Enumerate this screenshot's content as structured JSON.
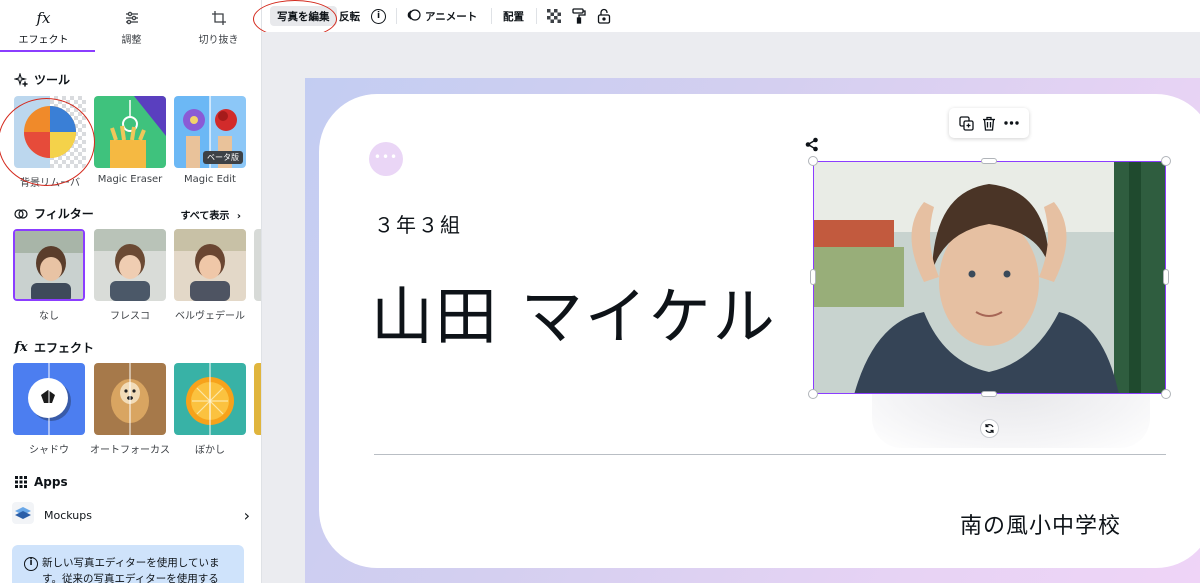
{
  "panel": {
    "tabs": [
      {
        "label": "エフェクト",
        "icon": "fx-icon",
        "glyph": "fx"
      },
      {
        "label": "調整",
        "icon": "sliders-icon"
      },
      {
        "label": "切り抜き",
        "icon": "crop-icon"
      }
    ],
    "tools": {
      "title": "ツール",
      "items": [
        {
          "label": "背景リムーバ"
        },
        {
          "label": "Magic Eraser"
        },
        {
          "label": "Magic Edit",
          "badge": "ベータ版"
        }
      ]
    },
    "filters": {
      "title": "フィルター",
      "show_all": "すべて表示",
      "items": [
        {
          "label": "なし"
        },
        {
          "label": "フレスコ"
        },
        {
          "label": "ベルヴェデール"
        }
      ]
    },
    "effects": {
      "title": "エフェクト",
      "glyph": "fx",
      "items": [
        {
          "label": "シャドウ"
        },
        {
          "label": "オートフォーカス"
        },
        {
          "label": "ぼかし"
        }
      ]
    },
    "apps": {
      "title": "Apps",
      "items": [
        {
          "label": "Mockups"
        }
      ]
    },
    "notice": {
      "text": "新しい写真エディターを使用していま す。従来の写真エディターを使用する"
    }
  },
  "toolbar": {
    "edit_photo": "写真を編集",
    "flip": "反転",
    "animate": "アニメート",
    "position": "配置"
  },
  "card": {
    "dots": "•••",
    "class_label": "３年３組",
    "student_name": "山田 マイケル",
    "school_name": "南の風小中学校"
  },
  "colors": {
    "accent": "#8b3dff",
    "annotation_circle": "#d42a1e",
    "notice_bg": "#cfe3fb",
    "page_gradient_start": "#c3cdf2",
    "page_gradient_end": "#efd4f7"
  }
}
